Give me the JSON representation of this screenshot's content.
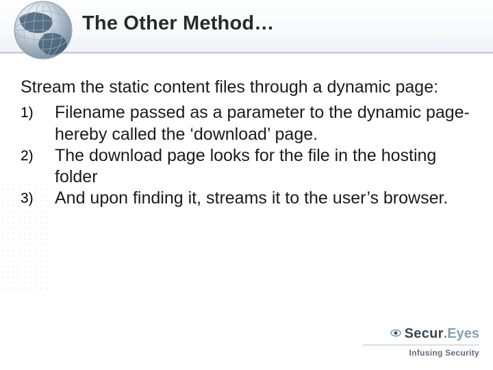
{
  "title": "The Other Method…",
  "intro": "Stream the static content files through a dynamic page:",
  "items": [
    {
      "num": "1)",
      "text": "Filename passed as a parameter to the dynamic page- hereby called the ‘download’ page."
    },
    {
      "num": "2)",
      "text": "The download page looks for the file in the hosting folder"
    },
    {
      "num": "3)",
      "text": "And upon finding it, streams it to the user’s browser."
    }
  ],
  "brand": {
    "part1": "Secur",
    "dot": ".",
    "part2": "Eyes"
  },
  "tagline": "Infusing Security"
}
